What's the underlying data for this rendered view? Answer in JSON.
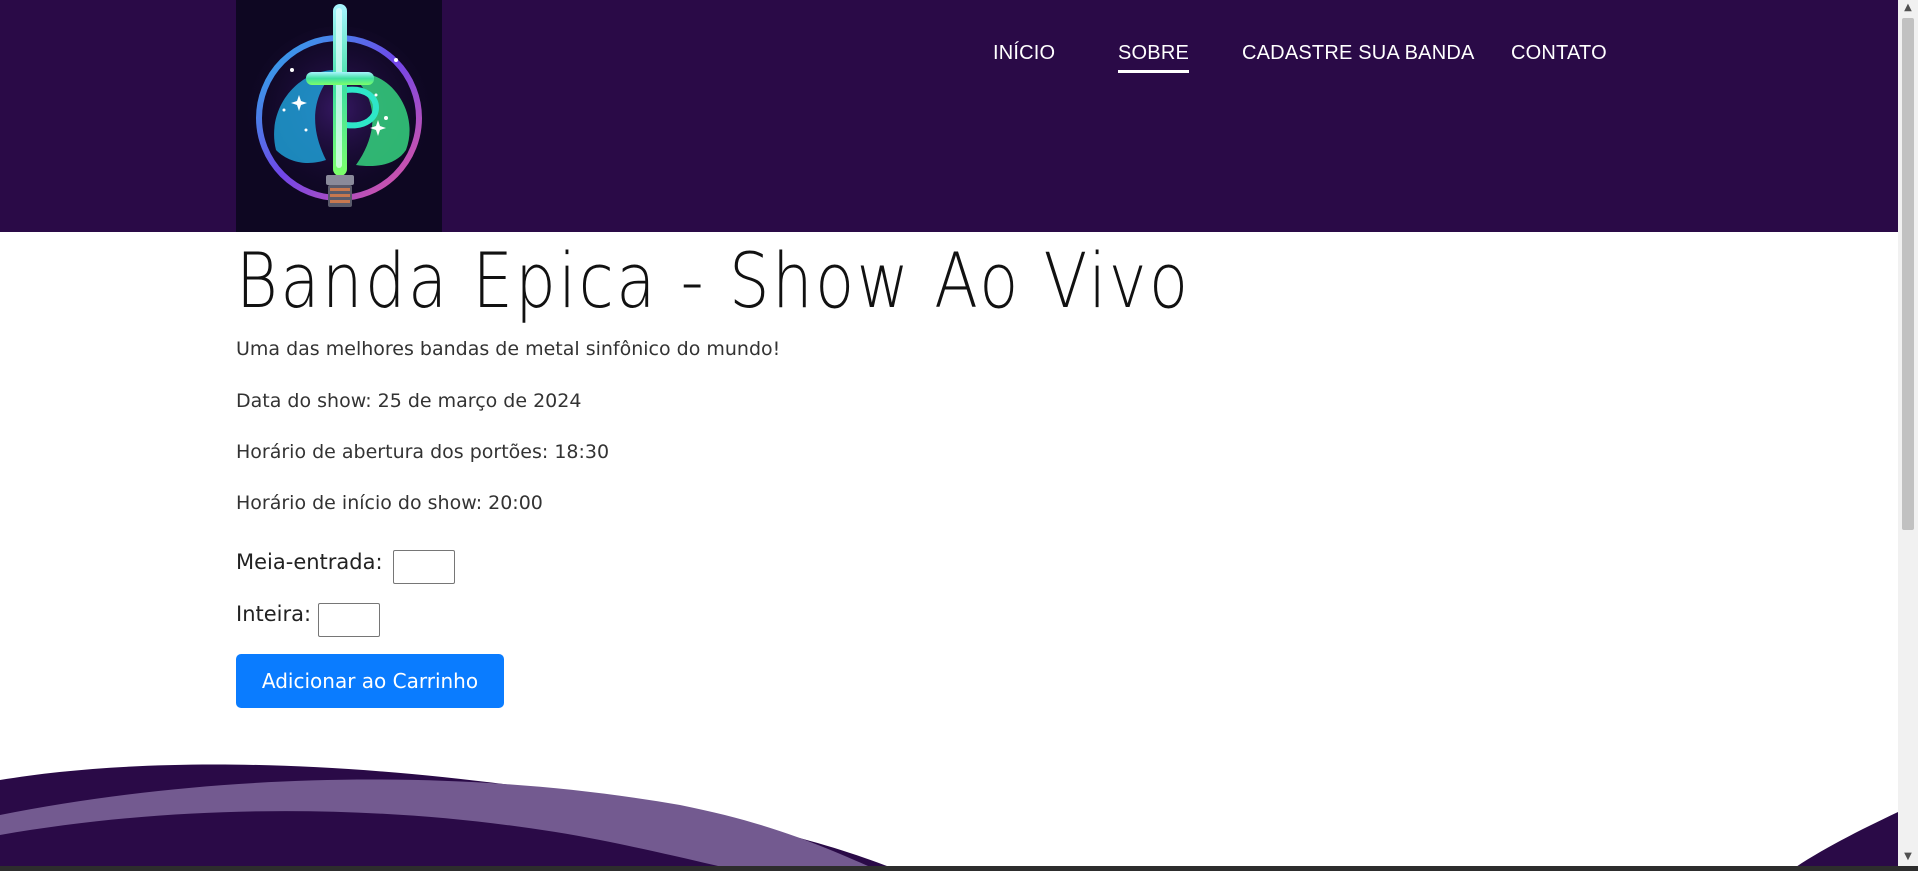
{
  "header": {
    "logo_icon": "lightsaber-cross-emblem",
    "nav": [
      {
        "label": "INÍCIO",
        "active": false
      },
      {
        "label": "SOBRE",
        "active": true
      },
      {
        "label": "CADASTRE SUA BANDA",
        "active": false
      },
      {
        "label": "CONTATO",
        "active": false
      }
    ]
  },
  "main": {
    "title": "Banda Epica - Show Ao Vivo",
    "subtitle": "Uma das melhores bandas de metal sinfônico do mundo!",
    "date": "Data do show: 25 de março de 2024",
    "gates": "Horário de abertura dos portões: 18:30",
    "start": "Horário de início do show: 20:00",
    "half_ticket_label": "Meia-entrada:",
    "half_ticket_value": "",
    "full_ticket_label": "Inteira:",
    "full_ticket_value": "",
    "cart_button": "Adicionar ao Carrinho"
  },
  "colors": {
    "header_bg": "#2a0a47",
    "wave_dark": "#2a0a47",
    "wave_light": "#735a90",
    "button_bg": "#0a7cff"
  }
}
